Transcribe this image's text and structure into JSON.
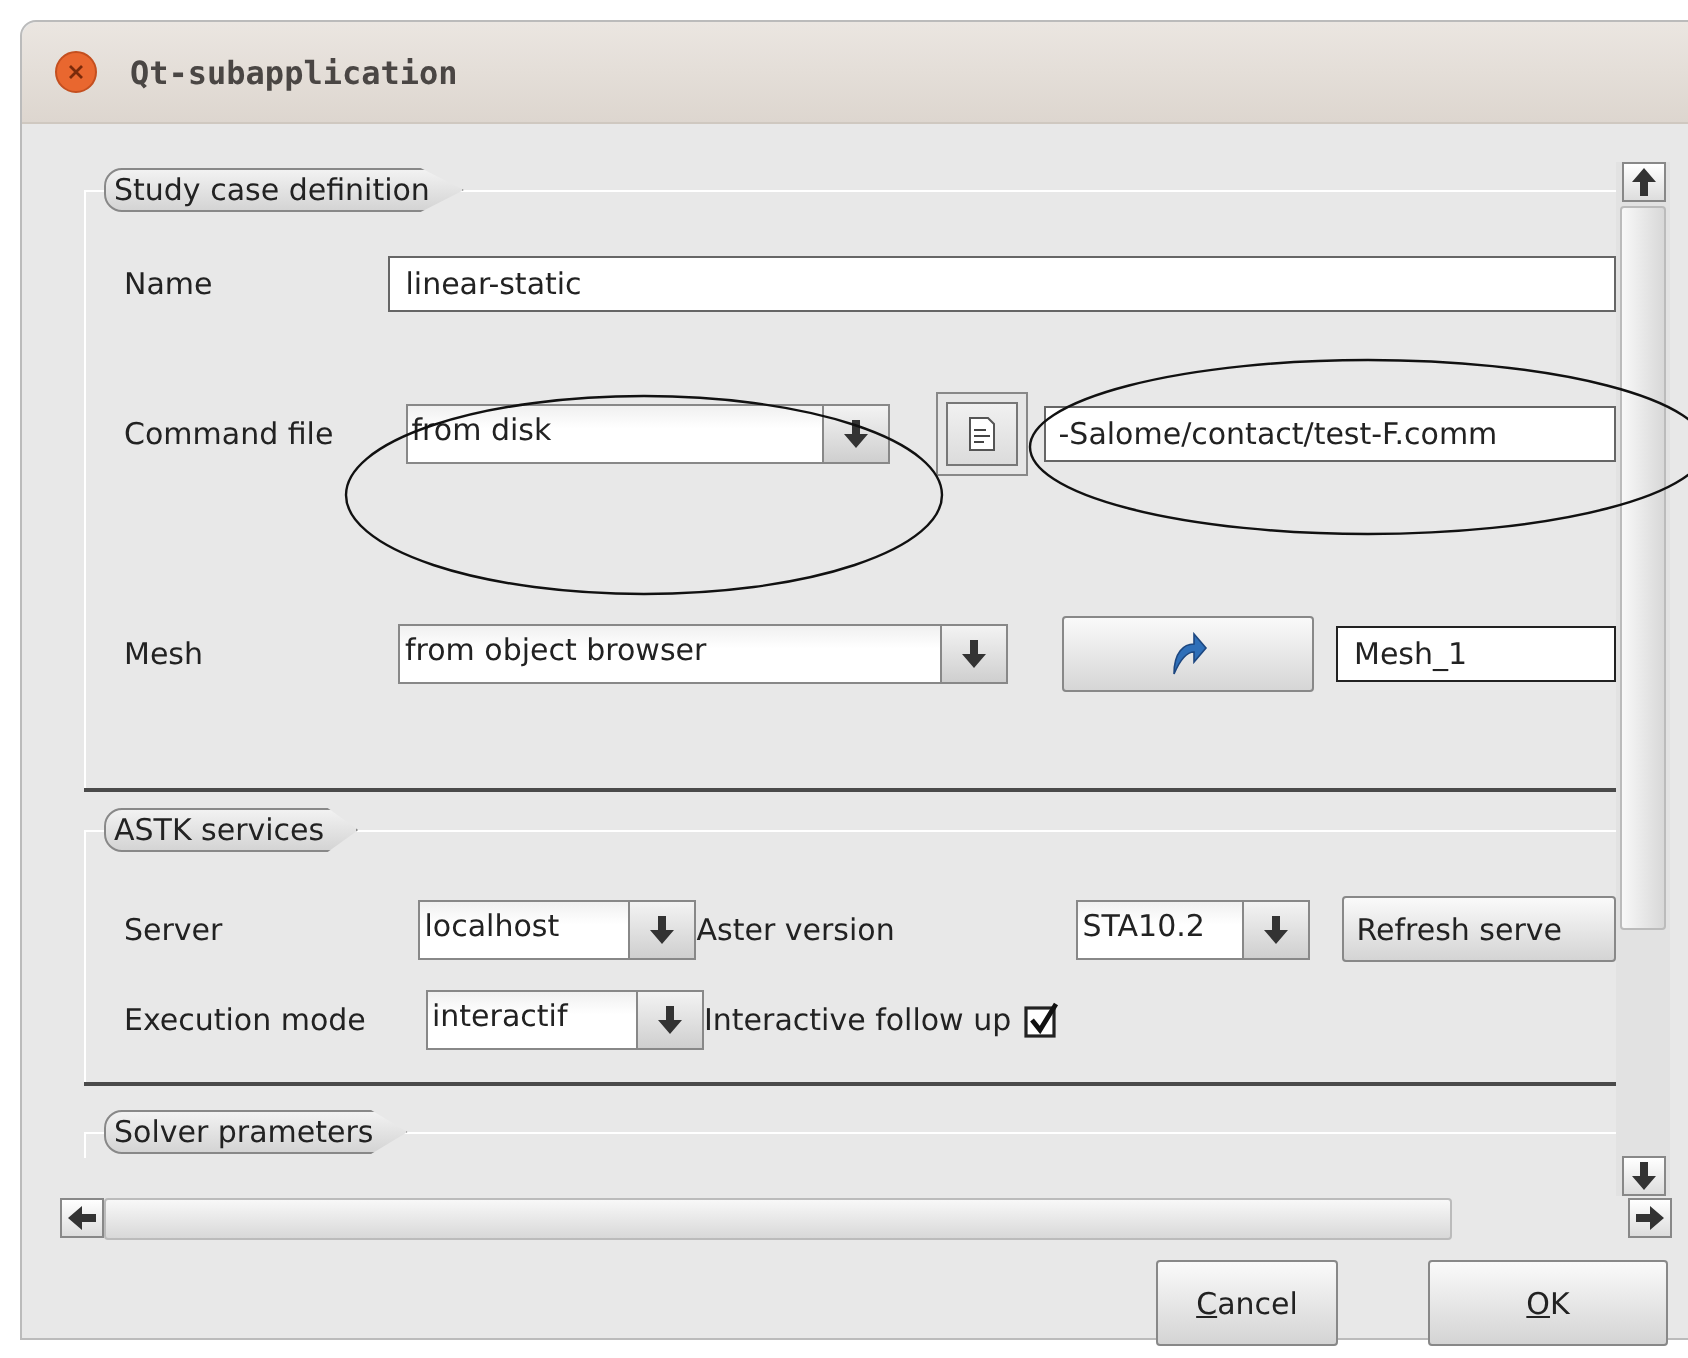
{
  "window": {
    "title": "Qt-subapplication"
  },
  "study_case": {
    "title": "Study case definition",
    "name": {
      "label": "Name",
      "value": "linear-static"
    },
    "command_file": {
      "label": "Command file",
      "source": "from disk",
      "path": "-Salome/contact/test-F.comm"
    },
    "mesh": {
      "label": "Mesh",
      "source": "from object browser",
      "value": "Mesh_1"
    }
  },
  "astk": {
    "title": "ASTK services",
    "server": {
      "label": "Server",
      "value": "localhost"
    },
    "aster_version": {
      "label": "Aster version",
      "value": "STA10.2"
    },
    "refresh_button": "Refresh serve",
    "execution_mode": {
      "label": "Execution mode",
      "value": "interactif"
    },
    "follow_up": {
      "label": "Interactive follow up",
      "checked": true
    }
  },
  "solver": {
    "title": "Solver prameters"
  },
  "buttons": [
    "Cancel",
    "OK"
  ]
}
